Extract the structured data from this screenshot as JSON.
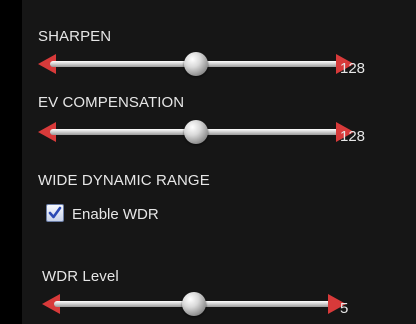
{
  "sharpen": {
    "label": "SHARPEN",
    "value": "128",
    "level": 0.5
  },
  "ev_compensation": {
    "label": "EV COMPENSATION",
    "value": "128",
    "level": 0.5
  },
  "wdr": {
    "section_label": "WIDE DYNAMIC RANGE",
    "enable_label": "Enable WDR",
    "enabled": true,
    "level_label": "WDR Level",
    "level_value": "5",
    "level": 0.5
  },
  "colors": {
    "arrow": "#d83a3a",
    "checkmark": "#2a49b5"
  }
}
